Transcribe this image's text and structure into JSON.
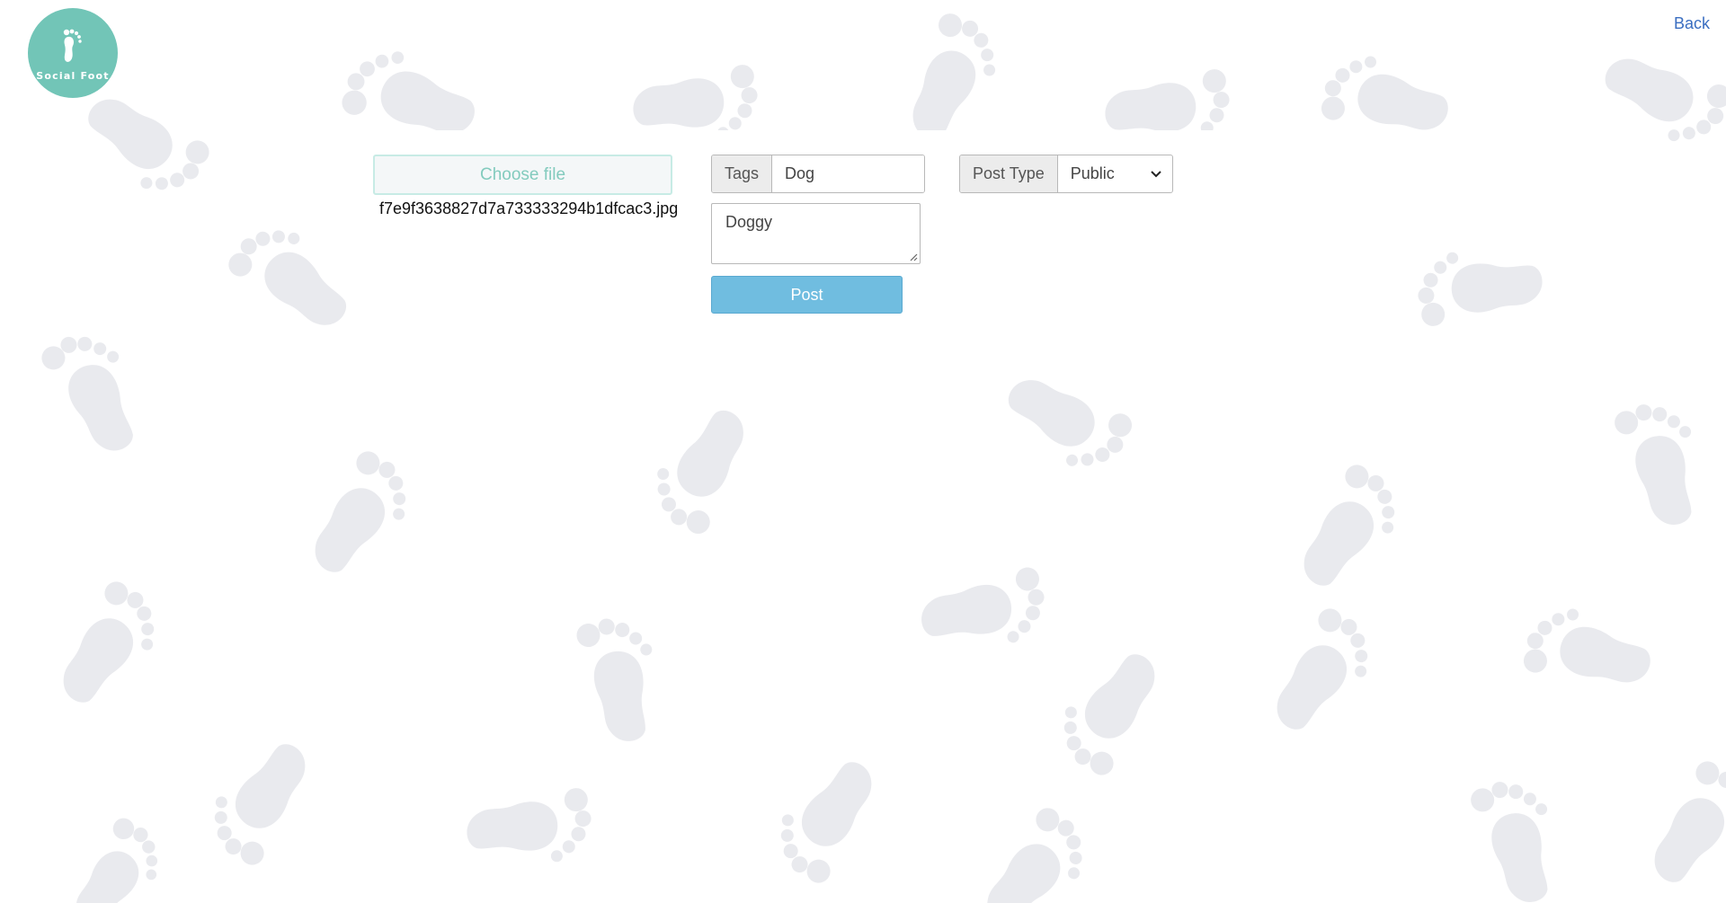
{
  "logo": {
    "text": "Social Foot",
    "icon": "footprint-icon",
    "color": "#72c5b7"
  },
  "header": {
    "back_label": "Back"
  },
  "form": {
    "file_button_label": "Choose file",
    "file_name": "f7e9f3638827d7a733333294b1dfcac3.jpg",
    "tags_label": "Tags",
    "tags_value": "Dog",
    "post_type_label": "Post Type",
    "post_type_value": "Public",
    "description_value": "Doggy",
    "post_button_label": "Post"
  },
  "colors": {
    "accent": "#72c5b7",
    "link": "#3a6ec1",
    "button": "#70bde0",
    "footprint": "#e9eaee"
  }
}
